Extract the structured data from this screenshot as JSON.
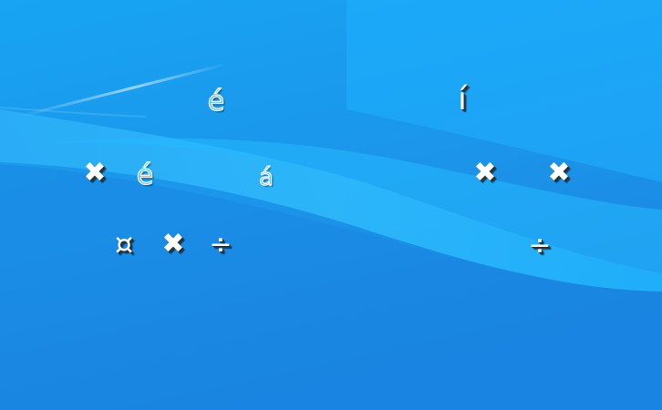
{
  "desktop": {
    "background": {
      "top_color": "#1aa7f5",
      "bottom_color": "#1b86e3",
      "wave_color": "#3bc3ff",
      "highlight_color": "#ffffff"
    },
    "icons": [
      {
        "id": "icon-1",
        "char": "é",
        "style": "outline",
        "icon": "e-acute-glyph-icon"
      },
      {
        "id": "icon-2",
        "char": "í",
        "style": "shadow",
        "icon": "i-acute-glyph-icon"
      },
      {
        "id": "icon-3",
        "char": "✖",
        "style": "shadow",
        "icon": "close-x-glyph-icon"
      },
      {
        "id": "icon-4",
        "char": "é",
        "style": "outline",
        "icon": "e-acute-glyph-icon"
      },
      {
        "id": "icon-5",
        "char": "á",
        "style": "outline",
        "icon": "a-acute-glyph-icon"
      },
      {
        "id": "icon-6",
        "char": "✖",
        "style": "shadow",
        "icon": "close-x-glyph-icon"
      },
      {
        "id": "icon-7",
        "char": "✖",
        "style": "shadow",
        "icon": "close-x-glyph-icon"
      },
      {
        "id": "icon-8",
        "char": "¤",
        "style": "shadow",
        "icon": "currency-sign-glyph-icon"
      },
      {
        "id": "icon-9",
        "char": "✖",
        "style": "shadow",
        "icon": "close-x-glyph-icon"
      },
      {
        "id": "icon-10",
        "char": "÷",
        "style": "shadow",
        "icon": "division-sign-glyph-icon"
      },
      {
        "id": "icon-11",
        "char": "÷",
        "style": "shadow",
        "icon": "division-sign-glyph-icon"
      }
    ]
  }
}
